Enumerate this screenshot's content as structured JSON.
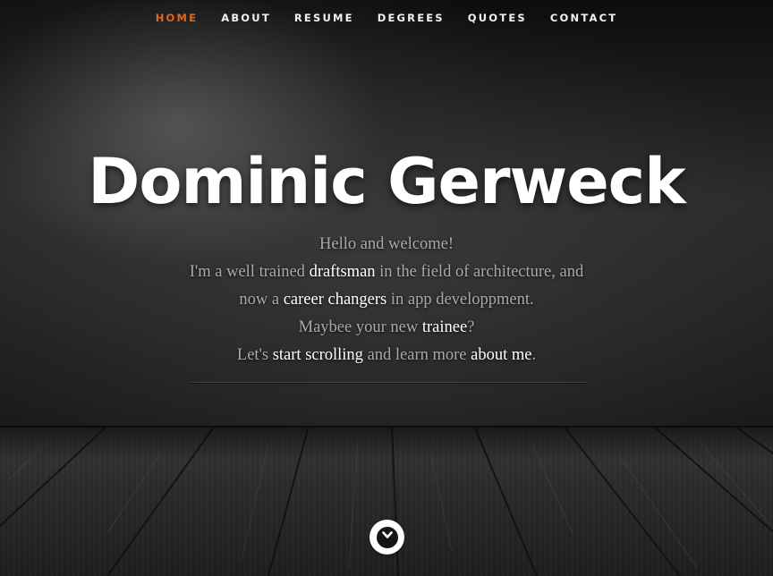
{
  "nav": {
    "items": [
      {
        "label": "HOME",
        "active": true
      },
      {
        "label": "ABOUT",
        "active": false
      },
      {
        "label": "RESUME",
        "active": false
      },
      {
        "label": "DEGREES",
        "active": false
      },
      {
        "label": "QUOTES",
        "active": false
      },
      {
        "label": "CONTACT",
        "active": false
      }
    ],
    "active_color": "#e0661d"
  },
  "hero": {
    "title": "Dominic Gerweck",
    "intro": {
      "line1": "Hello and welcome!",
      "line2_a": "I'm a well trained ",
      "line2_b": "draftsman",
      "line2_c": " in the field of architecture, and",
      "line3_a": "now a ",
      "line3_b": "career changers",
      "line3_c": " in app developpment.",
      "line4_a": "Maybee your new ",
      "line4_b": "trainee",
      "line4_c": "?",
      "line5_a": "Let's ",
      "line5_b": "start scrolling",
      "line5_c": " and learn more ",
      "line5_d": "about me",
      "line5_e": "."
    },
    "scroll_icon": "chevron-down-icon"
  }
}
